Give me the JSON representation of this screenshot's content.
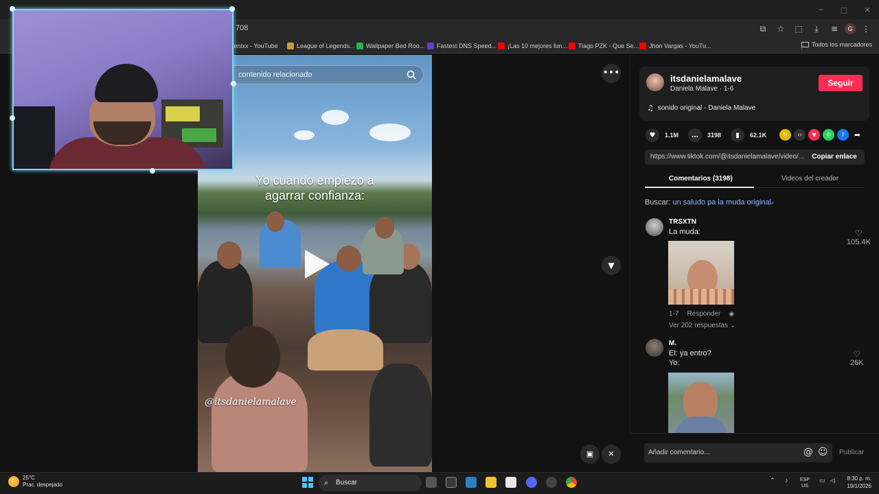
{
  "browser": {
    "window_controls": [
      "─",
      "□",
      "✕"
    ],
    "address_fragment": "708",
    "toolbar_icons": [
      "install-icon",
      "star-icon",
      "extensions-icon",
      "download-icon",
      "playlist-icon",
      "profile-icon",
      "menu-icon"
    ],
    "profile_initial": "G",
    "bookmarks": [
      {
        "label": "zenixx - YouTube",
        "icon": "youtube",
        "color": "#ff0000"
      },
      {
        "label": "League of Legends...",
        "icon": "lol",
        "color": "#c89b3c"
      },
      {
        "label": "Wallpaper Bed Roo...",
        "icon": "px",
        "color": "#2bb24c"
      },
      {
        "label": "Fastest DNS Speed...",
        "icon": "dns",
        "color": "#6a3bd1"
      },
      {
        "label": "¡Las 10 mejores fun...",
        "icon": "youtube",
        "color": "#ff0000"
      },
      {
        "label": "Tiago PZK - Que Se...",
        "icon": "youtube",
        "color": "#ff0000"
      },
      {
        "label": "Jhon Vargas - YouTu...",
        "icon": "youtube",
        "color": "#ff0000"
      }
    ],
    "all_bookmarks": "Todos los marcadores"
  },
  "video": {
    "search_placeholder": "contenido relacionado",
    "caption_line1": "Yo cuando empiezo a",
    "caption_line2": "agarrar confianza:",
    "watermark": "@itsdanielamalave"
  },
  "post": {
    "username": "itsdanielamalave",
    "display_name": "Daniela Malave · 1-6",
    "follow_label": "Seguir",
    "music": "sonido original - Daniela Malave",
    "likes": "1.1M",
    "comments_count": "3198",
    "saves": "62.1K",
    "link": "https://www.tiktok.com/@itsdanielamalave/video/...",
    "copy_label": "Copiar enlace",
    "tab_comments": "Comentarios (3198)",
    "tab_creator": "Videos del creador",
    "search_prefix": "Buscar:",
    "search_term": "un saludo pa la muda original"
  },
  "comments": [
    {
      "user": "TRSXTN",
      "text": "La muda:",
      "likes": "105.4K",
      "date": "1-7",
      "reply_label": "Responder",
      "view_replies": "Ver 202 respuestas"
    },
    {
      "user": "M.",
      "line1": "El: ya entro?",
      "line2": "Yo:",
      "likes": "26K"
    }
  ],
  "composer": {
    "placeholder": "Añadir comentario...",
    "publish_label": "Publicar"
  },
  "taskbar": {
    "temp": "25°C",
    "weather": "Prac. despejado",
    "search_label": "Buscar",
    "lang1": "ESP",
    "lang2": "US",
    "time": "8:30 p. m.",
    "date": "19/1/2026"
  },
  "colors": {
    "accent": "#fe2c55",
    "link": "#8fb6ff",
    "webcam_frame": "#7ad7f0"
  }
}
